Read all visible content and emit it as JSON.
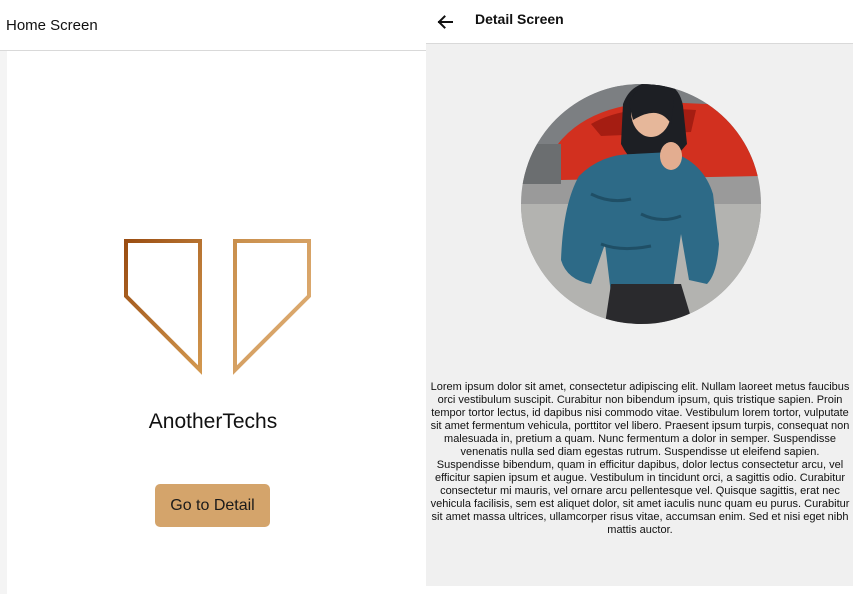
{
  "home": {
    "title": "Home Screen",
    "brand_name": "AnotherTechs",
    "cta_label": "Go to Detail",
    "logo_colors": [
      "#9a4d12",
      "#d9a46a"
    ]
  },
  "detail": {
    "title": "Detail Screen",
    "back_icon": "arrow-left-icon",
    "body_text": "Lorem ipsum dolor sit amet, consectetur adipiscing elit. Nullam laoreet metus faucibus orci vestibulum suscipit. Curabitur non bibendum ipsum, quis tristique sapien. Proin tempor tortor lectus, id dapibus nisi commodo vitae. Vestibulum lorem tortor, vulputate sit amet fermentum vehicula, porttitor vel libero. Praesent ipsum turpis, consequat non malesuada in, pretium a quam. Nunc fermentum a dolor in semper. Suspendisse venenatis nulla sed diam egestas rutrum. Suspendisse ut eleifend sapien. Suspendisse bibendum, quam in efficitur dapibus, dolor lectus consectetur arcu, vel efficitur sapien ipsum et augue. Vestibulum in tincidunt orci, a sagittis odio. Curabitur consectetur mi mauris, vel ornare arcu pellentesque vel. Quisque sagittis, erat nec vehicula facilisis, sem est aliquet dolor, sit amet iaculis nunc quam eu purus. Curabitur sit amet massa ultrices, ullamcorper risus vitae, accumsan enim. Sed et nisi eget nibh mattis auctor."
  },
  "colors": {
    "button_bg": "#d4a46b",
    "detail_bg": "#f0f0f0",
    "divider": "#d9d9d9"
  }
}
